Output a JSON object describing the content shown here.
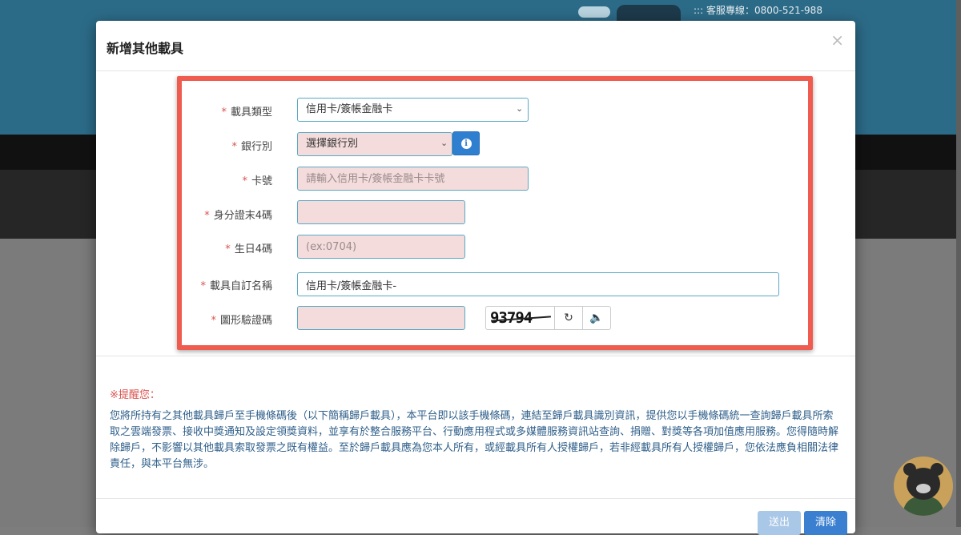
{
  "background": {
    "hotline": "::: 客服專線：0800-521-988"
  },
  "modal": {
    "title": "新增其他載具",
    "close": "×"
  },
  "form": {
    "carrier_type": {
      "label": "載具類型",
      "value": "信用卡/簽帳金融卡"
    },
    "bank": {
      "label": "銀行別",
      "value": "選擇銀行別",
      "info_icon": "i"
    },
    "card_number": {
      "label": "卡號",
      "placeholder": "請輸入信用卡/簽帳金融卡卡號"
    },
    "id_last4": {
      "label": "身分證末4碼",
      "value": ""
    },
    "birthday4": {
      "label": "生日4碼",
      "placeholder": "(ex:0704)"
    },
    "carrier_name": {
      "label": "載具自訂名稱",
      "value": "信用卡/簽帳金融卡-"
    },
    "captcha": {
      "label": "圖形驗證碼",
      "value": "",
      "code": "93794"
    },
    "required_mark": "*"
  },
  "reminder": {
    "title": "※提醒您：",
    "text": "您將所持有之其他載具歸戶至手機條碼後（以下簡稱歸戶載具），本平台即以該手機條碼，連結至歸戶載具識別資訊，提供您以手機條碼統一查詢歸戶載具所索取之雲端發票、接收中獎通知及設定領獎資料，並享有於整合服務平台、行動應用程式或多媒體服務資訊站查詢、捐贈、對獎等各項加值應用服務。您得隨時解除歸戶，不影響以其他載具索取發票之既有權益。至於歸戶載具應為您本人所有，或經載具所有人授權歸戶，若非經載具所有人授權歸戶，您依法應負相關法律責任，與本平台無涉。"
  },
  "footer": {
    "send_label": "送出",
    "clear_label": "清除"
  },
  "icons": {
    "refresh": "↻",
    "speaker": "🔈"
  },
  "colors": {
    "highlight": "#ef5b4f",
    "input_bg": "#f4dcdc",
    "required": "#d9534f",
    "primary": "#3b7fd0"
  }
}
